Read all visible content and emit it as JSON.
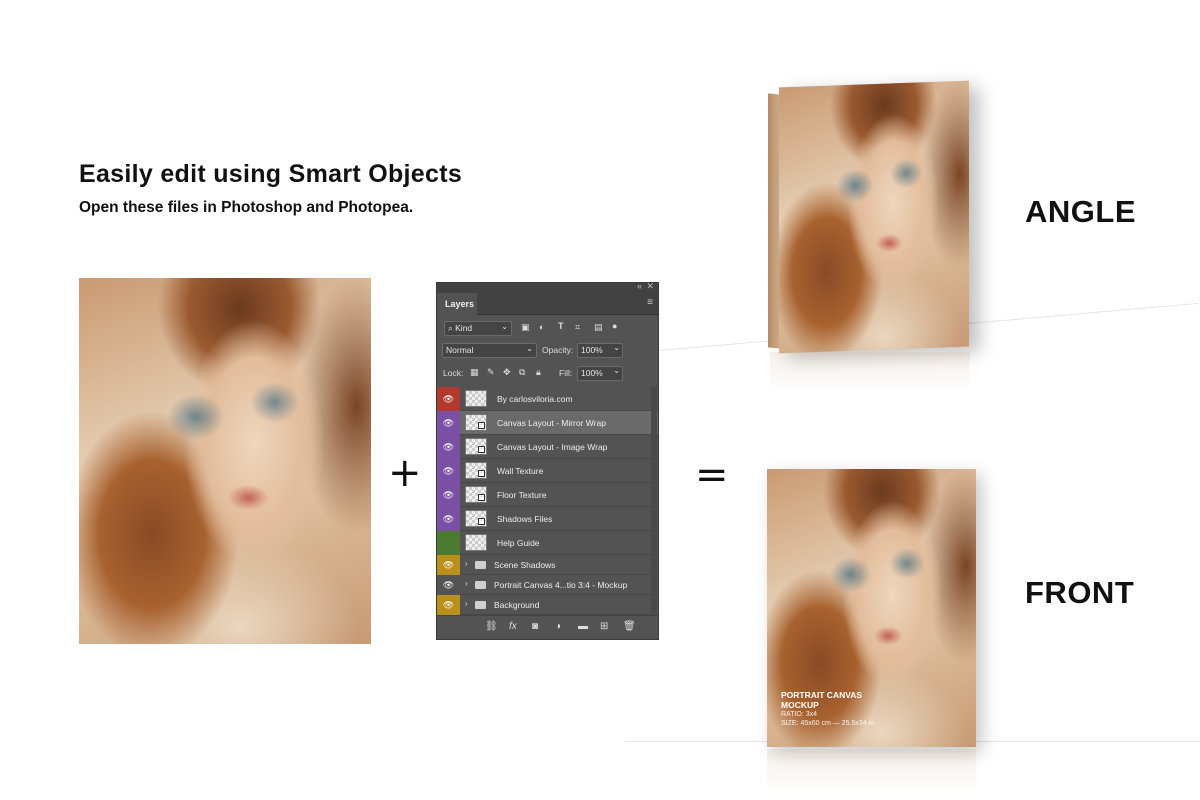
{
  "headline": "Easily edit using Smart Objects",
  "subheadline": "Open these files in Photoshop and Photopea.",
  "operators": {
    "plus": "+",
    "equals": "="
  },
  "views": {
    "angle": "ANGLE",
    "front": "FRONT"
  },
  "front_mockup_text": {
    "title_line1": "PORTRAIT CANVAS",
    "title_line2": "MOCKUP",
    "ratio": "RATIO: 3x4",
    "size": "SIZE: 45x60 cm — 25.5x34 in"
  },
  "layers_panel": {
    "tab": "Layers",
    "filter_kind": "Kind",
    "blend_mode": "Normal",
    "opacity_label": "Opacity:",
    "opacity_value": "100%",
    "lock_label": "Lock:",
    "fill_label": "Fill:",
    "fill_value": "100%",
    "layers": [
      {
        "name": "By carlosviloria.com",
        "color": "#b03a2e"
      },
      {
        "name": "Canvas Layout - Mirror Wrap",
        "color": "#7b4fa3"
      },
      {
        "name": "Canvas Layout - Image Wrap",
        "color": "#7b4fa3"
      },
      {
        "name": "Wall Texture",
        "color": "#7b4fa3"
      },
      {
        "name": "Floor Texture",
        "color": "#7b4fa3"
      },
      {
        "name": "Shadows Files",
        "color": "#7b4fa3"
      },
      {
        "name": "Help Guide",
        "color": "#4d7a32"
      }
    ],
    "groups": [
      {
        "name": "Scene Shadows",
        "color": "#b8901a"
      },
      {
        "name": "Portrait Canvas 4...tio 3:4 - Mockup",
        "color": "#535353"
      },
      {
        "name": "Background",
        "color": "#b8901a"
      }
    ]
  }
}
